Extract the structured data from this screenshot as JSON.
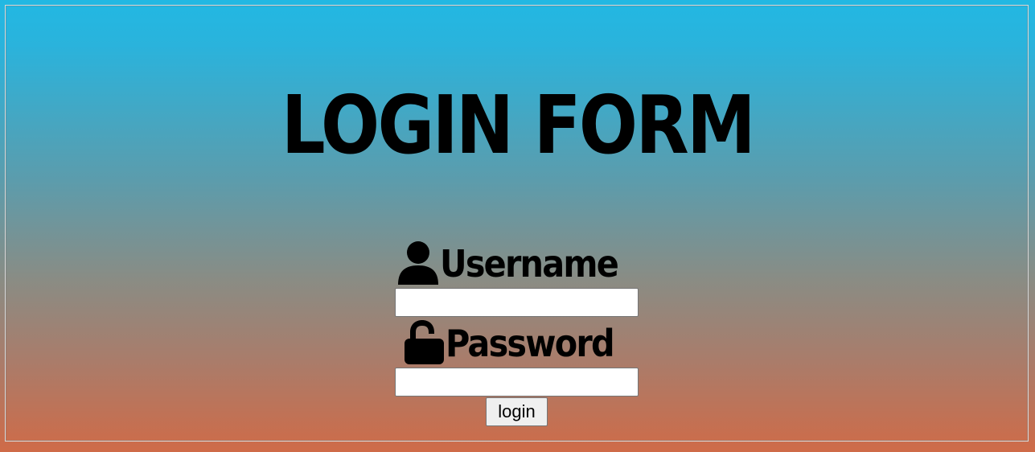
{
  "form": {
    "title": "LOGIN FORM",
    "username_label": "Username",
    "username_icon": "user-icon",
    "username_value": "",
    "password_label": "Password",
    "password_icon": "unlock-icon",
    "password_value": "",
    "submit_label": "login"
  },
  "colors": {
    "gradient_top": "#22b8e3",
    "gradient_bottom": "#cf6b48",
    "text": "#000000"
  }
}
